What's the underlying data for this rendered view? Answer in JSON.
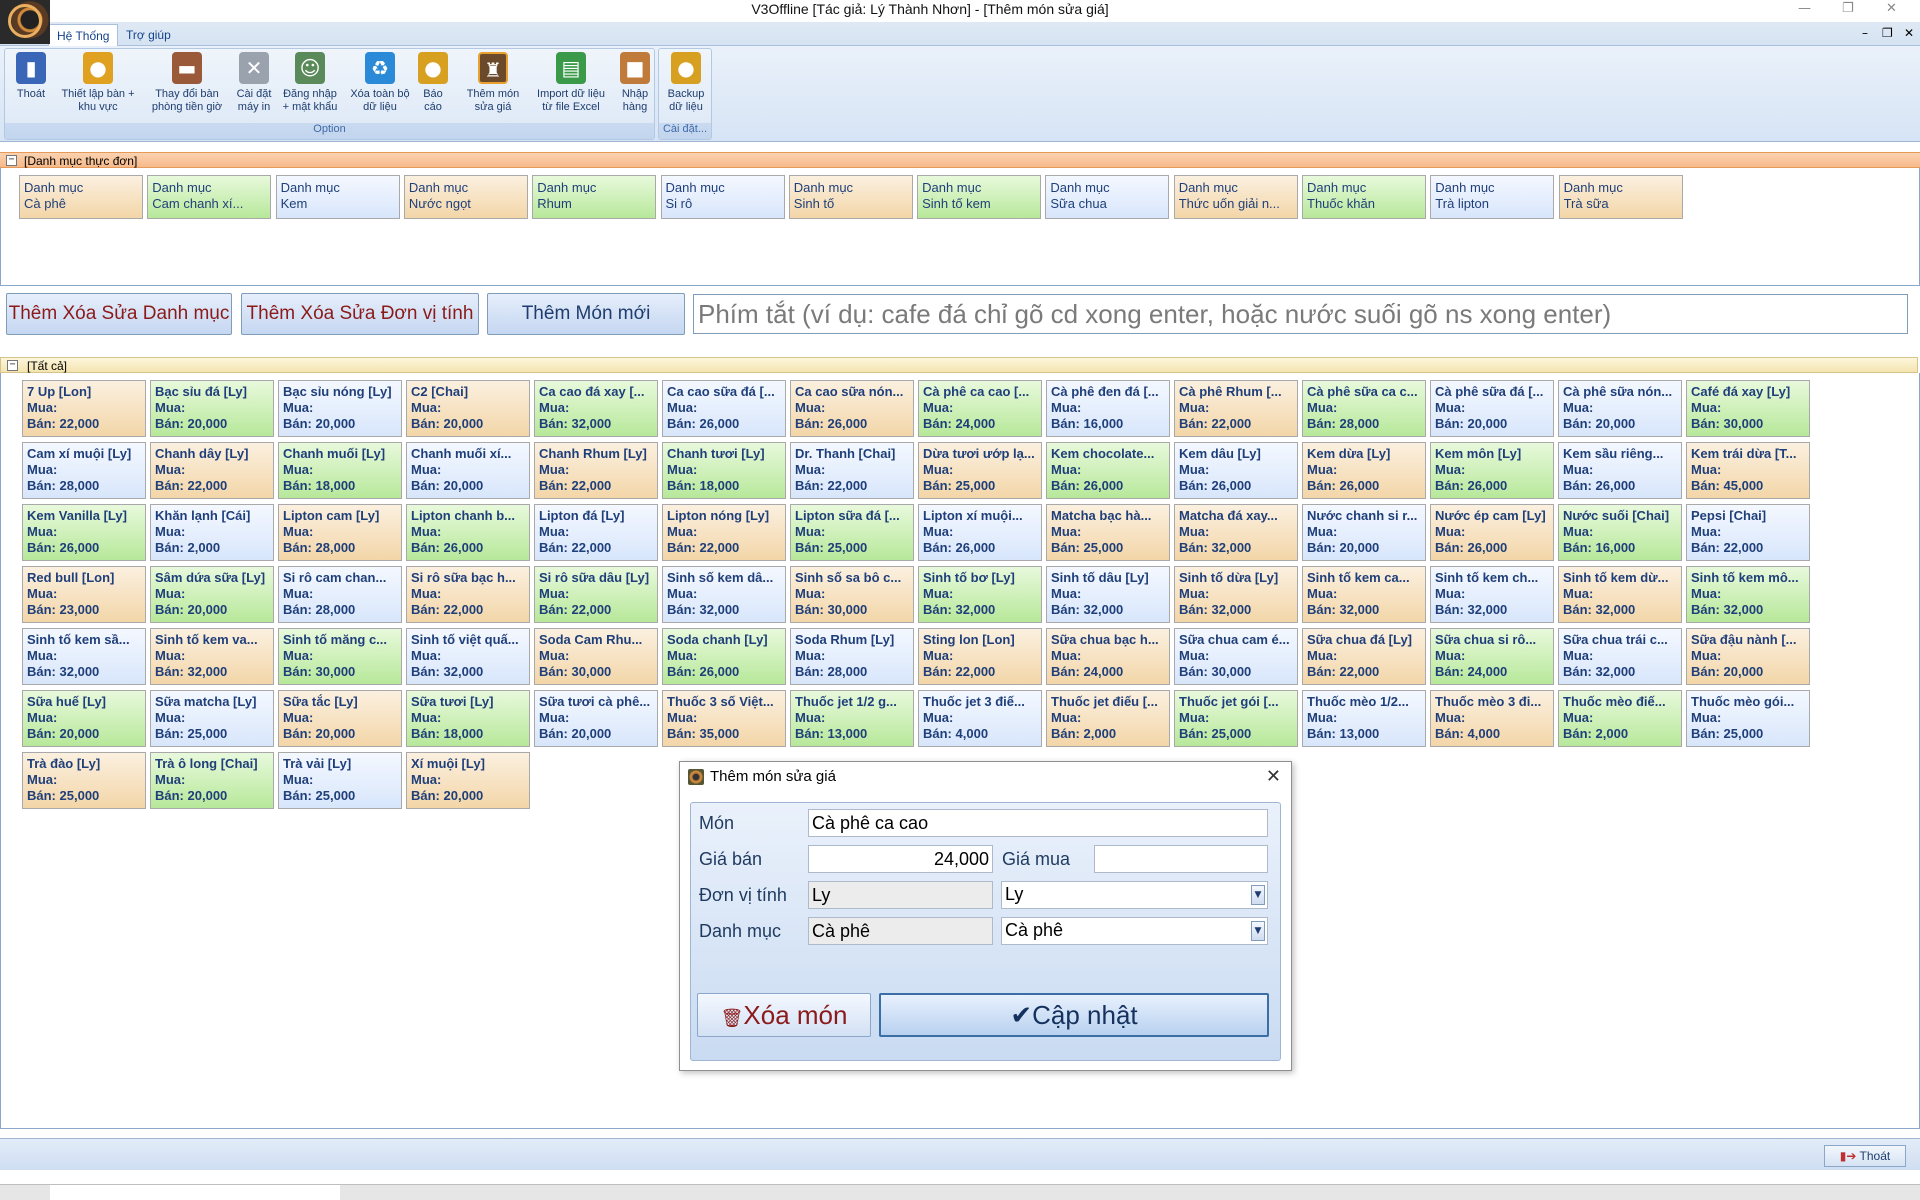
{
  "window": {
    "title": "V3Offline [Tác giả: Lý Thành Nhơn] - [Thêm món sửa giá]",
    "min": "—",
    "max": "❐",
    "close": "✕"
  },
  "ribbon_tabs": [
    "Hệ Thống",
    "Trợ giúp"
  ],
  "ribbon": {
    "option_group_label": "Option",
    "setting_group_label": "Cài đặt...",
    "buttons": [
      {
        "line1": "Thoát",
        "line2": "",
        "icon": "exit-door-icon"
      },
      {
        "line1": "Thiết lập bàn +",
        "line2": "khu vực",
        "icon": "coins-table-icon"
      },
      {
        "line1": "Thay đổi bàn",
        "line2": "phòng tiền giờ",
        "icon": "book-icon"
      },
      {
        "line1": "Cài đặt",
        "line2": "máy in",
        "icon": "tools-icon"
      },
      {
        "line1": "Đăng nhập",
        "line2": "+ mật khẩu",
        "icon": "users-icon"
      },
      {
        "line1": "Xóa toàn bộ",
        "line2": "dữ liệu",
        "icon": "recycle-icon"
      },
      {
        "line1": "Báo",
        "line2": "cáo",
        "icon": "coins-report-icon"
      },
      {
        "line1": "Thêm món",
        "line2": "sửa giá",
        "icon": "menu-edit-icon"
      },
      {
        "line1": "Import dữ liệu",
        "line2": "từ file Excel",
        "icon": "excel-file-icon"
      },
      {
        "line1": "Nhập",
        "line2": "hàng",
        "icon": "box-import-icon"
      },
      {
        "line1": "Backup",
        "line2": "dữ liệu",
        "icon": "backup-coins-icon"
      }
    ]
  },
  "categories": {
    "title": "[Danh mục thực đơn]",
    "items": [
      {
        "l1": "Danh mục",
        "l2": "Cà phê",
        "color": "orange"
      },
      {
        "l1": "Danh mục",
        "l2": "Cam chanh xí...",
        "color": "green"
      },
      {
        "l1": "Danh mục",
        "l2": "Kem",
        "color": "blue"
      },
      {
        "l1": "Danh mục",
        "l2": "Nước ngọt",
        "color": "orange"
      },
      {
        "l1": "Danh mục",
        "l2": "Rhum",
        "color": "green"
      },
      {
        "l1": "Danh mục",
        "l2": "Si rô",
        "color": "blue"
      },
      {
        "l1": "Danh mục",
        "l2": "Sinh tố",
        "color": "orange"
      },
      {
        "l1": "Danh mục",
        "l2": "Sinh tố kem",
        "color": "green"
      },
      {
        "l1": "Danh mục",
        "l2": "Sữa chua",
        "color": "blue"
      },
      {
        "l1": "Danh mục",
        "l2": "Thức uốn giải n...",
        "color": "orange"
      },
      {
        "l1": "Danh mục",
        "l2": "Thuốc khăn",
        "color": "green"
      },
      {
        "l1": "Danh mục",
        "l2": "Trà lipton",
        "color": "blue"
      },
      {
        "l1": "Danh mục",
        "l2": "Trà sữa",
        "color": "orange"
      }
    ]
  },
  "toolbar": {
    "category_btn": "Thêm Xóa Sửa Danh mục",
    "unit_btn": "Thêm Xóa Sửa Đơn vị tính",
    "new_item_btn": "Thêm Món mới",
    "shortcut_placeholder": "Phím tắt (ví dụ: cafe đá chỉ gõ cd xong enter, hoặc nước suối gõ ns xong enter)"
  },
  "all_items": {
    "title": "[Tất cả]",
    "buy_label": "Mua:",
    "sell_label": "Bán:",
    "items": [
      [
        "7 Up [Lon]",
        "22,000",
        "orange"
      ],
      [
        "Bạc sỉu đá [Ly]",
        "20,000",
        "green"
      ],
      [
        "Bạc sỉu nóng [Ly]",
        "20,000",
        "blue"
      ],
      [
        "C2 [Chai]",
        "20,000",
        "orange"
      ],
      [
        "Ca cao đá xay [...",
        "32,000",
        "green"
      ],
      [
        "Ca cao sữa đá [...",
        "26,000",
        "blue"
      ],
      [
        "Ca cao sữa nón...",
        "26,000",
        "orange"
      ],
      [
        "Cà phê ca cao [...",
        "24,000",
        "green"
      ],
      [
        "Cà phê đen đá [...",
        "16,000",
        "blue"
      ],
      [
        "Cà phê Rhum [...",
        "22,000",
        "orange"
      ],
      [
        "Cà phê sữa ca c...",
        "28,000",
        "green"
      ],
      [
        "Cà phê sữa đá [...",
        "20,000",
        "blue"
      ],
      [
        "Cà phê sữa nón...",
        "20,000",
        "blue"
      ],
      [
        "Café đá xay [Ly]",
        "30,000",
        "green"
      ],
      [
        "Cam xí muội [Ly]",
        "28,000",
        "blue"
      ],
      [
        "Chanh dây [Ly]",
        "22,000",
        "orange"
      ],
      [
        "Chanh muối [Ly]",
        "18,000",
        "green"
      ],
      [
        "Chanh muối xí...",
        "20,000",
        "blue"
      ],
      [
        "Chanh Rhum [Ly]",
        "22,000",
        "orange"
      ],
      [
        "Chanh tươi [Ly]",
        "18,000",
        "green"
      ],
      [
        "Dr. Thanh [Chai]",
        "22,000",
        "blue"
      ],
      [
        "Dừa tươi ướp lạ...",
        "25,000",
        "orange"
      ],
      [
        "Kem chocolate...",
        "26,000",
        "green"
      ],
      [
        "Kem dâu [Ly]",
        "26,000",
        "blue"
      ],
      [
        "Kem dừa [Ly]",
        "26,000",
        "orange"
      ],
      [
        "Kem môn [Ly]",
        "26,000",
        "green"
      ],
      [
        "Kem sầu riêng...",
        "26,000",
        "blue"
      ],
      [
        "Kem trái dừa [T...",
        "45,000",
        "orange"
      ],
      [
        "Kem Vanilla [Ly]",
        "26,000",
        "green"
      ],
      [
        "Khăn lạnh [Cái]",
        "2,000",
        "blue"
      ],
      [
        "Lipton cam [Ly]",
        "28,000",
        "orange"
      ],
      [
        "Lipton chanh b...",
        "26,000",
        "green"
      ],
      [
        "Lipton đá [Ly]",
        "22,000",
        "blue"
      ],
      [
        "Lipton nóng [Ly]",
        "22,000",
        "orange"
      ],
      [
        "Lipton sữa đá [...",
        "25,000",
        "green"
      ],
      [
        "Lipton xí muội...",
        "26,000",
        "blue"
      ],
      [
        "Matcha bạc hà...",
        "25,000",
        "orange"
      ],
      [
        "Matcha đá xay...",
        "32,000",
        "orange"
      ],
      [
        "Nước chanh si r...",
        "20,000",
        "blue"
      ],
      [
        "Nước ép cam [Ly]",
        "26,000",
        "orange"
      ],
      [
        "Nước suối [Chai]",
        "16,000",
        "green"
      ],
      [
        "Pepsi [Chai]",
        "22,000",
        "blue"
      ],
      [
        "Red bull [Lon]",
        "23,000",
        "orange"
      ],
      [
        "Sâm dứa sữa [Ly]",
        "20,000",
        "green"
      ],
      [
        "Si rô cam chan...",
        "28,000",
        "blue"
      ],
      [
        "Si rô sữa bạc h...",
        "22,000",
        "orange"
      ],
      [
        "Si rô sữa dâu [Ly]",
        "22,000",
        "green"
      ],
      [
        "Sinh số kem dâ...",
        "32,000",
        "blue"
      ],
      [
        "Sinh số sa bô c...",
        "30,000",
        "orange"
      ],
      [
        "Sinh tố bơ [Ly]",
        "32,000",
        "green"
      ],
      [
        "Sinh tố dâu [Ly]",
        "32,000",
        "blue"
      ],
      [
        "Sinh tố dừa [Ly]",
        "32,000",
        "orange"
      ],
      [
        "Sinh tố kem ca...",
        "32,000",
        "orange"
      ],
      [
        "Sinh tố kem ch...",
        "32,000",
        "blue"
      ],
      [
        "Sinh tố kem dừ...",
        "32,000",
        "orange"
      ],
      [
        "Sinh tố kem mô...",
        "32,000",
        "green"
      ],
      [
        "Sinh tố kem sầ...",
        "32,000",
        "blue"
      ],
      [
        "Sinh tố kem va...",
        "32,000",
        "orange"
      ],
      [
        "Sinh tố măng c...",
        "30,000",
        "green"
      ],
      [
        "Sinh tố việt quấ...",
        "32,000",
        "blue"
      ],
      [
        "Soda Cam Rhu...",
        "30,000",
        "orange"
      ],
      [
        "Soda chanh [Ly]",
        "26,000",
        "green"
      ],
      [
        "Soda Rhum [Ly]",
        "28,000",
        "blue"
      ],
      [
        "Sting lon [Lon]",
        "22,000",
        "orange"
      ],
      [
        "Sữa chua bạc h...",
        "24,000",
        "orange"
      ],
      [
        "Sữa chua cam é...",
        "30,000",
        "blue"
      ],
      [
        "Sữa chua đá [Ly]",
        "22,000",
        "orange"
      ],
      [
        "Sữa chua si rô...",
        "24,000",
        "green"
      ],
      [
        "Sữa chua trái c...",
        "32,000",
        "blue"
      ],
      [
        "Sữa đậu nành [...",
        "20,000",
        "orange"
      ],
      [
        "Sữa huế [Ly]",
        "20,000",
        "green"
      ],
      [
        "Sữa matcha [Ly]",
        "25,000",
        "blue"
      ],
      [
        "Sữa tắc [Ly]",
        "20,000",
        "orange"
      ],
      [
        "Sữa tươi [Ly]",
        "18,000",
        "green"
      ],
      [
        "Sữa tươi cà phê...",
        "20,000",
        "blue"
      ],
      [
        "Thuốc 3 số Việt...",
        "35,000",
        "orange"
      ],
      [
        "Thuốc jet 1/2 g...",
        "13,000",
        "green"
      ],
      [
        "Thuốc jet 3 điế...",
        "4,000",
        "blue"
      ],
      [
        "Thuốc jet điếu [...",
        "2,000",
        "orange"
      ],
      [
        "Thuốc jet gói [...",
        "25,000",
        "green"
      ],
      [
        "Thuốc mèo 1/2...",
        "13,000",
        "blue"
      ],
      [
        "Thuốc mèo 3 đi...",
        "4,000",
        "orange"
      ],
      [
        "Thuốc mèo điế...",
        "2,000",
        "green"
      ],
      [
        "Thuốc mèo gói...",
        "25,000",
        "blue"
      ],
      [
        "Trà đào [Ly]",
        "25,000",
        "orange"
      ],
      [
        "Trà ô long [Chai]",
        "20,000",
        "green"
      ],
      [
        "Trà vải [Ly]",
        "25,000",
        "blue"
      ],
      [
        "Xí muội [Ly]",
        "20,000",
        "orange"
      ]
    ]
  },
  "dialog": {
    "title": "Thêm món sửa giá",
    "close": "✕",
    "mon_label": "Món",
    "mon_value": "Cà phê ca cao",
    "gia_ban_label": "Giá bán",
    "gia_ban_value": "24,000",
    "gia_mua_label": "Giá mua",
    "gia_mua_value": "",
    "don_vi_label": "Đơn vị tính",
    "don_vi_value": "Ly",
    "don_vi_select": "Ly",
    "danh_muc_label": "Danh mục",
    "danh_muc_value": "Cà phê",
    "danh_muc_select": "Cà phê",
    "delete_btn": "Xóa món",
    "update_btn": "Cập nhật"
  },
  "status": {
    "exit_label": "Thoát"
  },
  "colors": {
    "orange": "#f3d6a8",
    "green": "#b7e89a",
    "blue": "#d8e6fb",
    "accent_red": "#8b1a1a"
  }
}
